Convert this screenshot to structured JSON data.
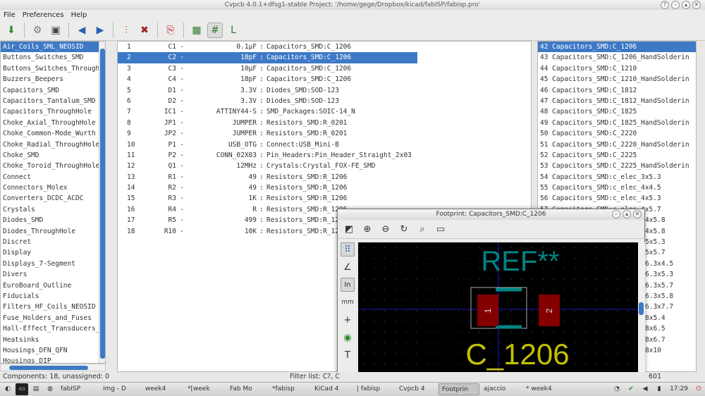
{
  "window": {
    "title": "Cvpcb 4.0.1+dfsg1-stable  Project: '/home/gege/Dropbox/kicad/fabISP/fabisp.pro'"
  },
  "menu": [
    "File",
    "Preferences",
    "Help"
  ],
  "libraries": [
    "Air_Coils_SML_NEOSID",
    "Buttons_Switches_SMD",
    "Buttons_Switches_ThroughH",
    "Buzzers_Beepers",
    "Capacitors_SMD",
    "Capacitors_Tantalum_SMD",
    "Capacitors_ThroughHole",
    "Choke_Axial_ThroughHole",
    "Choke_Common-Mode_Wurth",
    "Choke_Radial_ThroughHole",
    "Choke_SMD",
    "Choke_Toroid_ThroughHole",
    "Connect",
    "Connectors_Molex",
    "Converters_DCDC_ACDC",
    "Crystals",
    "Diodes_SMD",
    "Diodes_ThroughHole",
    "Discret",
    "Display",
    "Displays_7-Segment",
    "Divers",
    "EuroBoard_Outline",
    "Fiducials",
    "Filters_HF_Coils_NEOSID",
    "Fuse_Holders_and_Fuses",
    "Hall-Effect_Transducers_L",
    "Heatsinks",
    "Housings_DFN_QFN",
    "Housings_DIP"
  ],
  "components": [
    {
      "n": "1",
      "ref": "C1",
      "val": "0.1μF",
      "fp": "Capacitors_SMD:C_1206"
    },
    {
      "n": "2",
      "ref": "C2",
      "val": "18pF",
      "fp": "Capacitors_SMD:C_1206"
    },
    {
      "n": "3",
      "ref": "C3",
      "val": "10μF",
      "fp": "Capacitors_SMD:C_1206"
    },
    {
      "n": "4",
      "ref": "C4",
      "val": "18pF",
      "fp": "Capacitors_SMD:C_1206"
    },
    {
      "n": "5",
      "ref": "D1",
      "val": "3.3V",
      "fp": "Diodes_SMD:SOD-123"
    },
    {
      "n": "6",
      "ref": "D2",
      "val": "3.3V",
      "fp": "Diodes_SMD:SOD-123"
    },
    {
      "n": "7",
      "ref": "IC1",
      "val": "ATTINY44-S",
      "fp": "SMD_Packages:SOIC-14_N"
    },
    {
      "n": "8",
      "ref": "JP1",
      "val": "JUMPER",
      "fp": "Resistors_SMD:R_0201"
    },
    {
      "n": "9",
      "ref": "JP2",
      "val": "JUMPER",
      "fp": "Resistors_SMD:R_0201"
    },
    {
      "n": "10",
      "ref": "P1",
      "val": "USB_OTG",
      "fp": "Connect:USB_Mini-B"
    },
    {
      "n": "11",
      "ref": "P2",
      "val": "CONN_02X03",
      "fp": "Pin_Headers:Pin_Header_Straight_2x03"
    },
    {
      "n": "12",
      "ref": "Q1",
      "val": "12MHz",
      "fp": "Crystals:Crystal_FOX-FE_SMD"
    },
    {
      "n": "13",
      "ref": "R1",
      "val": "49",
      "fp": "Resistors_SMD:R_1206"
    },
    {
      "n": "14",
      "ref": "R2",
      "val": "49",
      "fp": "Resistors_SMD:R_1206"
    },
    {
      "n": "15",
      "ref": "R3",
      "val": "1K",
      "fp": "Resistors_SMD:R_1206"
    },
    {
      "n": "16",
      "ref": "R4",
      "val": "R",
      "fp": "Resistors_SMD:R_1206"
    },
    {
      "n": "17",
      "ref": "R5",
      "val": "499",
      "fp": "Resistors_SMD:R_120"
    },
    {
      "n": "18",
      "ref": "R10",
      "val": "10K",
      "fp": "Resistors_SMD:R_120"
    }
  ],
  "footprints": [
    "42 Capacitors_SMD:C_1206",
    "43 Capacitors_SMD:C_1206_HandSolderin",
    "44 Capacitors_SMD:C_1210",
    "45 Capacitors_SMD:C_1210_HandSolderin",
    "46 Capacitors_SMD:C_1812",
    "47 Capacitors_SMD:C_1812_HandSolderin",
    "48 Capacitors_SMD:C_1825",
    "49 Capacitors_SMD:C_1825_HandSolderin",
    "50 Capacitors_SMD:C_2220",
    "51 Capacitors_SMD:C_2220_HandSolderin",
    "52 Capacitors_SMD:C_2225",
    "53 Capacitors_SMD:C_2225_HandSolderin",
    "54 Capacitors_SMD:c_elec_3x5.3",
    "55 Capacitors_SMD:c_elec_4x4.5",
    "56 Capacitors_SMD:c_elec_4x5.3",
    "57 Capacitors_SMD:c_elec_4x5.7"
  ],
  "footprints_peek": [
    "4x5.8",
    "4x5.8",
    "5x5.3",
    "5x5.7",
    "6.3x4.5",
    "6.3x5.3",
    "6.3x5.7",
    "6.3x5.8",
    "6.3x7.7",
    "8x5.4",
    "8x6.5",
    "8x6.7",
    "8x10"
  ],
  "status": {
    "left": "Components: 18, unassigned: 0",
    "middle": "Filter list: C?, C",
    "right": "601"
  },
  "viewer": {
    "title": "Footprint: Capacitors_SMD:C_1206",
    "ref_text": "REF**",
    "value_text": "C_1206",
    "pad1": "1",
    "pad2": "2"
  },
  "taskbar": [
    "fabISP",
    "img - D",
    "week4",
    "*[week",
    "Fab Mo",
    "*fabisp",
    "KiCad 4",
    "| fabisp",
    "Cvpcb 4",
    "Footprin",
    "ajaccio",
    "* week4"
  ],
  "clock": "17:29",
  "colors": {
    "selection": "#3d79c6",
    "ref_text": "#008484",
    "value_text": "#c2c200",
    "pad": "#840000",
    "grid_axis": "#1c1cbe"
  }
}
